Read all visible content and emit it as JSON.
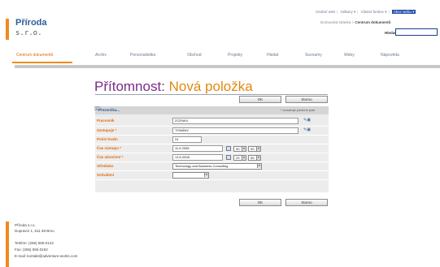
{
  "brand": {
    "name": "Příroda",
    "subtitle": "s.r.o."
  },
  "top_links": {
    "items": [
      "Osobní web",
      "Odkazy ▾",
      "Vlastní funkce ▾",
      "Akce webu ▾"
    ],
    "breadcrumb_prefix": "Domovská stránka > ",
    "breadcrumb_current": "Centrum dokumentů",
    "search_label": "Hledat"
  },
  "nav": {
    "items": [
      "Centrum dokumentů",
      "Archiv",
      "Personalistika",
      "Obchod",
      "Projekty",
      "Hledat",
      "Seznamy",
      "Weby",
      "Nápověda"
    ],
    "active_index": 0
  },
  "page": {
    "title_list": "Přítomnost",
    "title_sep": ": ",
    "title_action": "Nová položka"
  },
  "buttons": {
    "ok": "OK",
    "cancel": "Storno"
  },
  "panel": {
    "title": "Prezenčka...",
    "required_note": "* označuje povinné pole"
  },
  "fields": {
    "employee": {
      "label": "Pracovník",
      "value": "ZCENKU"
    },
    "replacement": {
      "label": "Zastupuje",
      "value": "TOMÁNV"
    },
    "days_count": {
      "label": "Počet hodin",
      "value": "24"
    },
    "start": {
      "label": "Čas nástupu",
      "date": "11.6.2008",
      "hour": "00",
      "minute": "00"
    },
    "end": {
      "label": "Čas ukončení",
      "date": "13.6.2008",
      "hour": "23",
      "minute": "55"
    },
    "department": {
      "label": "Středisko",
      "value": "Technology and Business Consulting"
    },
    "approval": {
      "label": "Schválení",
      "value": ""
    }
  },
  "footer": {
    "company": "Příroda s.r.o.",
    "address": "Dopravní 1, 611 38 Brno",
    "phone": "Telefon: (266) 555-0143",
    "fax": "Fax: (266) 555-0162",
    "email": "E-mail: kontakt@adventure-works.com"
  },
  "colors": {
    "accent": "#f08a1c",
    "brand": "#2c5d97",
    "title_list": "#7a2a86",
    "title_action": "#e0890e",
    "label": "#e26a0a"
  },
  "icons": {
    "calendar": "calendar-icon",
    "lookup": "address-book-icon",
    "panel": "form-icon"
  }
}
